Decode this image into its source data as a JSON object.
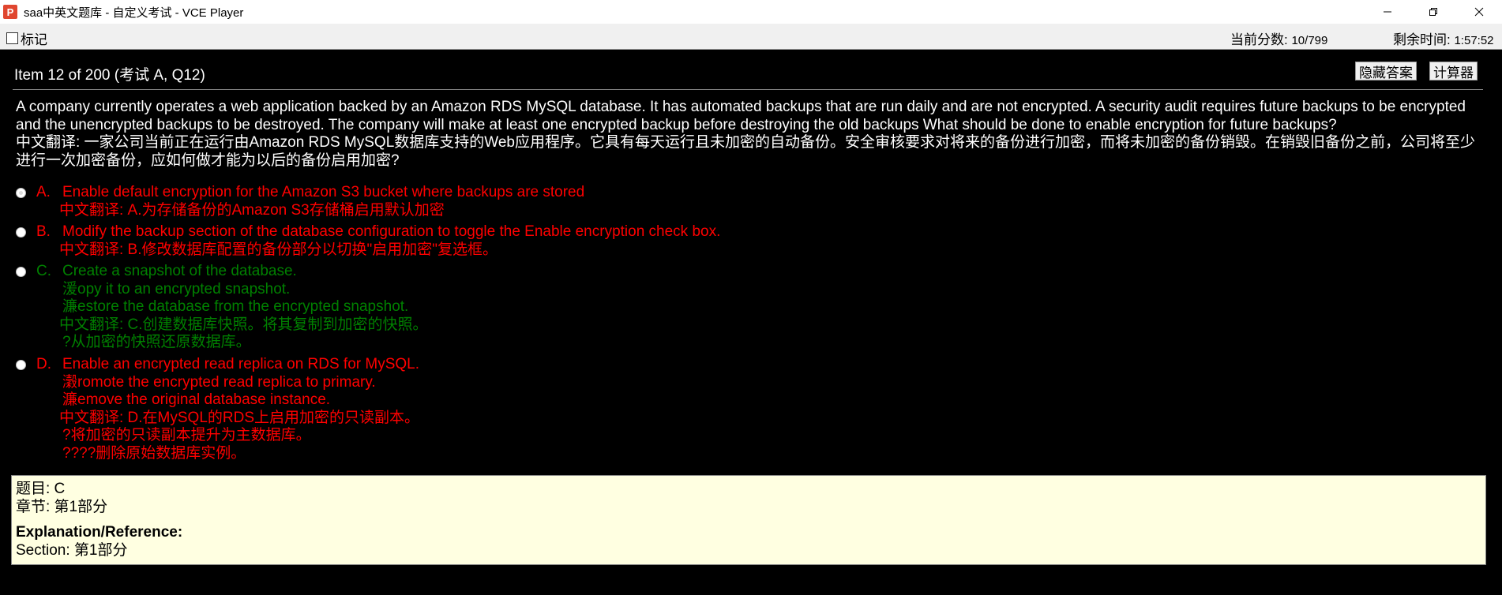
{
  "window": {
    "title": "saa中英文题库 - 自定义考试 - VCE Player",
    "icon_letter": "P"
  },
  "toolbar": {
    "mark_label": "标记",
    "score_label": "当前分数:",
    "score_value": "10/799",
    "time_label": "剩余时间:",
    "time_value": "1:57:52"
  },
  "item": {
    "title": "Item 12 of 200  (考试 A, Q12)",
    "hide_answer_label": "隐藏答案",
    "calculator_label": "计算器"
  },
  "question": {
    "en": " A company currently operates a web application backed by an Amazon RDS MySQL database. It has automated backups that are run daily and are not encrypted. A security audit requires future backups to be encrypted and the unencrypted backups to be destroyed. The company will make at least one encrypted backup before destroying the old backups What should be done to enable encryption for future backups?",
    "zh": " 中文翻译: 一家公司当前正在运行由Amazon RDS MySQL数据库支持的Web应用程序。它具有每天运行且未加密的自动备份。安全审核要求对将来的备份进行加密，而将未加密的备份销毁。在销毁旧备份之前，公司将至少进行一次加密备份，应如何做才能为以后的备份启用加密?"
  },
  "options": [
    {
      "letter": "A.",
      "color": "#ff0000",
      "selected": true,
      "lines": [
        "Enable default encryption for the Amazon S3 bucket where backups are stored"
      ],
      "translation": [
        "中文翻译: A.为存储备份的Amazon S3存储桶启用默认加密"
      ]
    },
    {
      "letter": "B.",
      "color": "#ff0000",
      "selected": false,
      "lines": [
        "Modify the backup section of the database configuration to toggle the Enable encryption check box."
      ],
      "translation": [
        "中文翻译: B.修改数据库配置的备份部分以切换\"启用加密\"复选框。"
      ]
    },
    {
      "letter": "C.",
      "color": "#008000",
      "selected": false,
      "lines": [
        "Create a snapshot of the database.",
        "湲opy it to an encrypted snapshot.",
        "濂estore the database from the encrypted snapshot."
      ],
      "translation": [
        "中文翻译: C.创建数据库快照。将其复制到加密的快照。",
        "?从加密的快照还原数据库。"
      ]
    },
    {
      "letter": "D.",
      "color": "#ff0000",
      "selected": false,
      "lines": [
        "Enable an encrypted read replica on RDS for MySQL.",
        "瀔romote the encrypted read replica to primary.",
        "濂emove the original database instance."
      ],
      "translation": [
        "中文翻译: D.在MySQL的RDS上启用加密的只读副本。",
        "?将加密的只读副本提升为主数据库。",
        "????删除原始数据库实例。"
      ]
    }
  ],
  "answer": {
    "answer_line": "题目: C",
    "section_line": "章节: 第1部分",
    "explanation_label": "Explanation/Reference:",
    "reference_line": "Section: 第1部分"
  },
  "colors": {
    "background": "#000000",
    "correct": "#008000",
    "wrong": "#ff0000",
    "answer_box": "#ffffe1"
  }
}
